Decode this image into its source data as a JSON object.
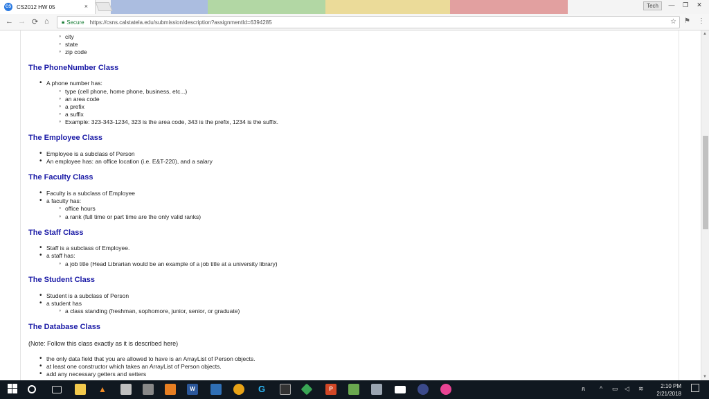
{
  "browser": {
    "tab_title": "CS2012 HW 05",
    "tab_favicon": "CS",
    "tab_close": "×",
    "user_badge": "Tech",
    "minimize": "—",
    "maximize": "❐",
    "close": "✕",
    "secure_label": "Secure",
    "url": "https://csns.calstatela.edu/submission/description?assignmentId=6394285",
    "back_icon": "←",
    "forward_icon": "→",
    "reload_icon": "⟳",
    "home_icon": "⌂",
    "star_icon": "☆",
    "menu_icon": "⋮",
    "ext_icon": "⚑"
  },
  "document": {
    "top_list": [
      "city",
      "state",
      "zip code"
    ],
    "phone": {
      "heading": "The PhoneNumber Class",
      "item": "A phone number has:",
      "sub": [
        "type (cell phone, home phone, business, etc...)",
        "an area code",
        "a prefix",
        "a suffix",
        "Example: 323-343-1234, 323 is the area code, 343 is the prefix, 1234 is the suffix."
      ]
    },
    "employee": {
      "heading": "The Employee Class",
      "items": [
        "Employee is a subclass of Person",
        "An employee has: an office location (i.e. E&T-220), and a salary"
      ]
    },
    "faculty": {
      "heading": "The Faculty Class",
      "items": [
        "Faculty is a subclass of Employee",
        "a faculty has:"
      ],
      "sub": [
        "office hours",
        "a rank (full time or part time are the only valid ranks)"
      ]
    },
    "staff": {
      "heading": "The Staff Class",
      "items": [
        "Staff is a subclass of Employee.",
        "a staff has:"
      ],
      "sub": [
        "a job title (Head Librarian would be an example of a job title at a university library)"
      ]
    },
    "student": {
      "heading": "The Student Class",
      "items": [
        "Student is a subclass of Person",
        "a student has"
      ],
      "sub": [
        "a class standing (freshman, sophomore, junior, senior, or graduate)"
      ]
    },
    "database": {
      "heading": "The Database Class",
      "note": "(Note: Follow this class exactly as it is described here)",
      "items": [
        "the only data field that you are allowed to have is an ArrayList of Person objects.",
        "at least one constructor which takes an ArrayList of Person objects.",
        "add any necessary getters and setters"
      ]
    }
  },
  "taskbar": {
    "time": "2:10 PM",
    "date": "2/21/2018",
    "start_icon": "windows-logo-icon"
  },
  "colors": {
    "heading": "#1a1aa6",
    "secure": "#1a7f37",
    "taskbar": "#101820"
  }
}
